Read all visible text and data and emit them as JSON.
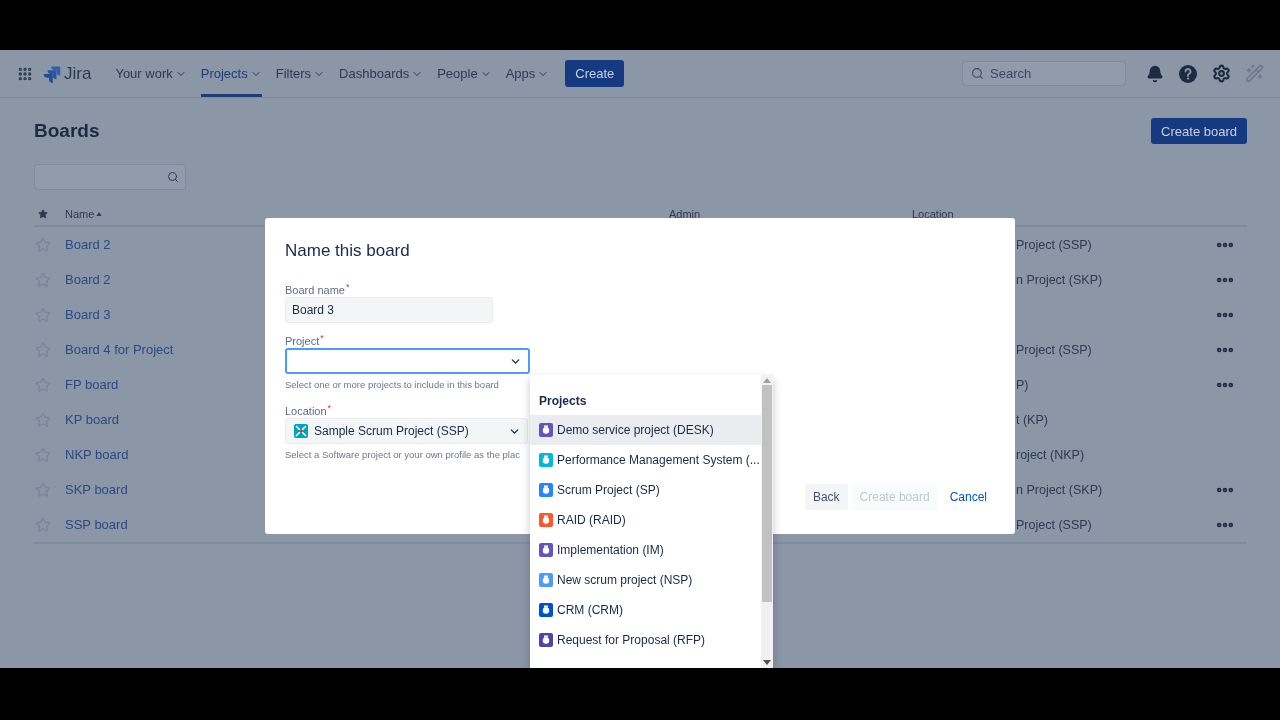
{
  "nav": {
    "logo": "Jira",
    "items": [
      {
        "label": "Your work",
        "selected": false
      },
      {
        "label": "Projects",
        "selected": true
      },
      {
        "label": "Filters",
        "selected": false
      },
      {
        "label": "Dashboards",
        "selected": false
      },
      {
        "label": "People",
        "selected": false
      },
      {
        "label": "Apps",
        "selected": false
      }
    ],
    "create": "Create",
    "search": {
      "placeholder": "Search"
    }
  },
  "page": {
    "title": "Boards",
    "create_button": "Create board",
    "columns": [
      "Name",
      "Admin",
      "Location"
    ],
    "rows": [
      {
        "name": "Board 2",
        "location": "Project (SSP)",
        "has_menu": true
      },
      {
        "name": "Board 2",
        "location": "n Project (SKP)",
        "has_menu": true
      },
      {
        "name": "Board 3",
        "has_menu": true
      },
      {
        "name": "Board 4 for Project",
        "location": "Project (SSP)",
        "has_menu": true
      },
      {
        "name": "FP board",
        "location": "P)",
        "has_menu": true
      },
      {
        "name": "KP board",
        "location": "t (KP)",
        "has_menu": false
      },
      {
        "name": "NKP board",
        "location": "roject (NKP)",
        "has_menu": false
      },
      {
        "name": "SKP board",
        "location": "n Project (SKP)",
        "has_menu": true
      },
      {
        "name": "SSP board",
        "location": "Project (SSP)",
        "has_menu": true
      }
    ]
  },
  "modal": {
    "title": "Name this board",
    "fields": [
      {
        "kind": "text",
        "label": "Board name$^{*}$",
        "value": "Board 3",
        "focused": false
      },
      {
        "kind": "select",
        "label": "Project$^{*}$",
        "focused": true,
        "helper": "Select one or more projects to include in this board"
      },
      {
        "kind": "select",
        "label": "Location$^{*}$",
        "value": "Sample Scrum Project (SSP)",
        "focused": false,
        "helper": "Select a Software project or your own profile as the plac"
      }
    ],
    "buttons": [
      {
        "label": "Back",
        "kind": "secondary",
        "disabled": false
      },
      {
        "label": "Create board",
        "kind": "primary",
        "disabled": true
      },
      {
        "label": "Cancel",
        "kind": "link",
        "disabled": false
      }
    ]
  },
  "dropdown": {
    "heading": "Projects",
    "items": [
      {
        "label": "Demo service project (DESK)",
        "color": "#6554c0",
        "selected": true
      },
      {
        "label": "Performance Management System (...",
        "color": "#00b8d9",
        "selected": false
      },
      {
        "label": "Scrum Project (SP)",
        "color": "#2684ff",
        "selected": false
      },
      {
        "label": "RAID (RAID)",
        "color": "#ff5630",
        "selected": false
      },
      {
        "label": "Implementation (IM)",
        "color": "#6554c0",
        "selected": false
      },
      {
        "label": "New scrum project (NSP)",
        "color": "#4c9aff",
        "selected": false
      },
      {
        "label": "CRM (CRM)",
        "color": "#0052cc",
        "selected": false
      },
      {
        "label": "Request for Proposal (RFP)",
        "color": "#5243aa",
        "selected": false
      }
    ]
  }
}
